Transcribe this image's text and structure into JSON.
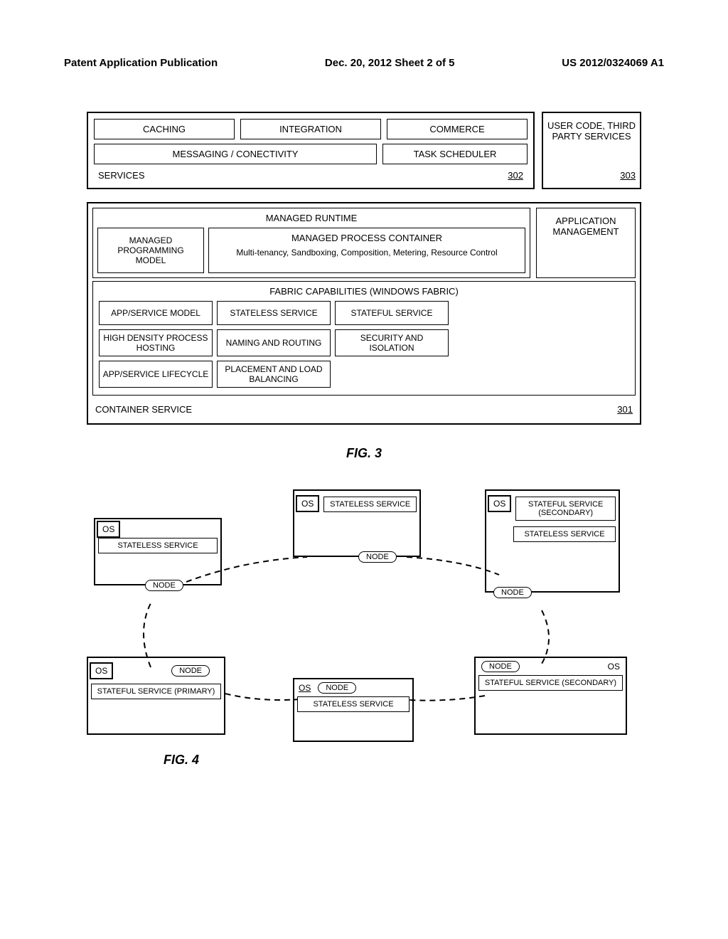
{
  "header": {
    "left": "Patent Application Publication",
    "center": "Dec. 20, 2012  Sheet 2 of 5",
    "right": "US 2012/0324069 A1"
  },
  "fig3": {
    "services": {
      "row1": [
        "CACHING",
        "INTEGRATION",
        "COMMERCE"
      ],
      "row2": [
        "MESSAGING / CONECTIVITY",
        "TASK SCHEDULER"
      ],
      "label": "SERVICES",
      "ref": "302"
    },
    "userCode": {
      "text": "USER CODE, THIRD PARTY SERVICES",
      "ref": "303"
    },
    "managedRuntime": {
      "title": "MANAGED RUNTIME",
      "mpm": "MANAGED PROGRAMMING MODEL",
      "mpc": {
        "title": "MANAGED PROCESS CONTAINER",
        "desc": "Multi-tenancy, Sandboxing, Composition, Metering, Resource Control"
      }
    },
    "appMgmt": "APPLICATION MANAGEMENT",
    "fabric": {
      "title": "FABRIC CAPABILITIES (WINDOWS FABRIC)",
      "cells": [
        "APP/SERVICE MODEL",
        "STATELESS SERVICE",
        "STATEFUL SERVICE",
        "HIGH DENSITY PROCESS HOSTING",
        "NAMING AND ROUTING",
        "SECURITY AND ISOLATION",
        "APP/SERVICE LIFECYCLE",
        "PLACEMENT AND LOAD BALANCING"
      ]
    },
    "containerService": {
      "label": "CONTAINER SERVICE",
      "ref": "301"
    },
    "caption": "FIG. 3"
  },
  "fig4": {
    "os": "OS",
    "node": "NODE",
    "stateless": "STATELESS SERVICE",
    "statefulPrimary": "STATEFUL SERVICE (PRIMARY)",
    "statefulSecondary": "STATEFUL SERVICE (SECONDARY)",
    "caption": "FIG. 4"
  }
}
